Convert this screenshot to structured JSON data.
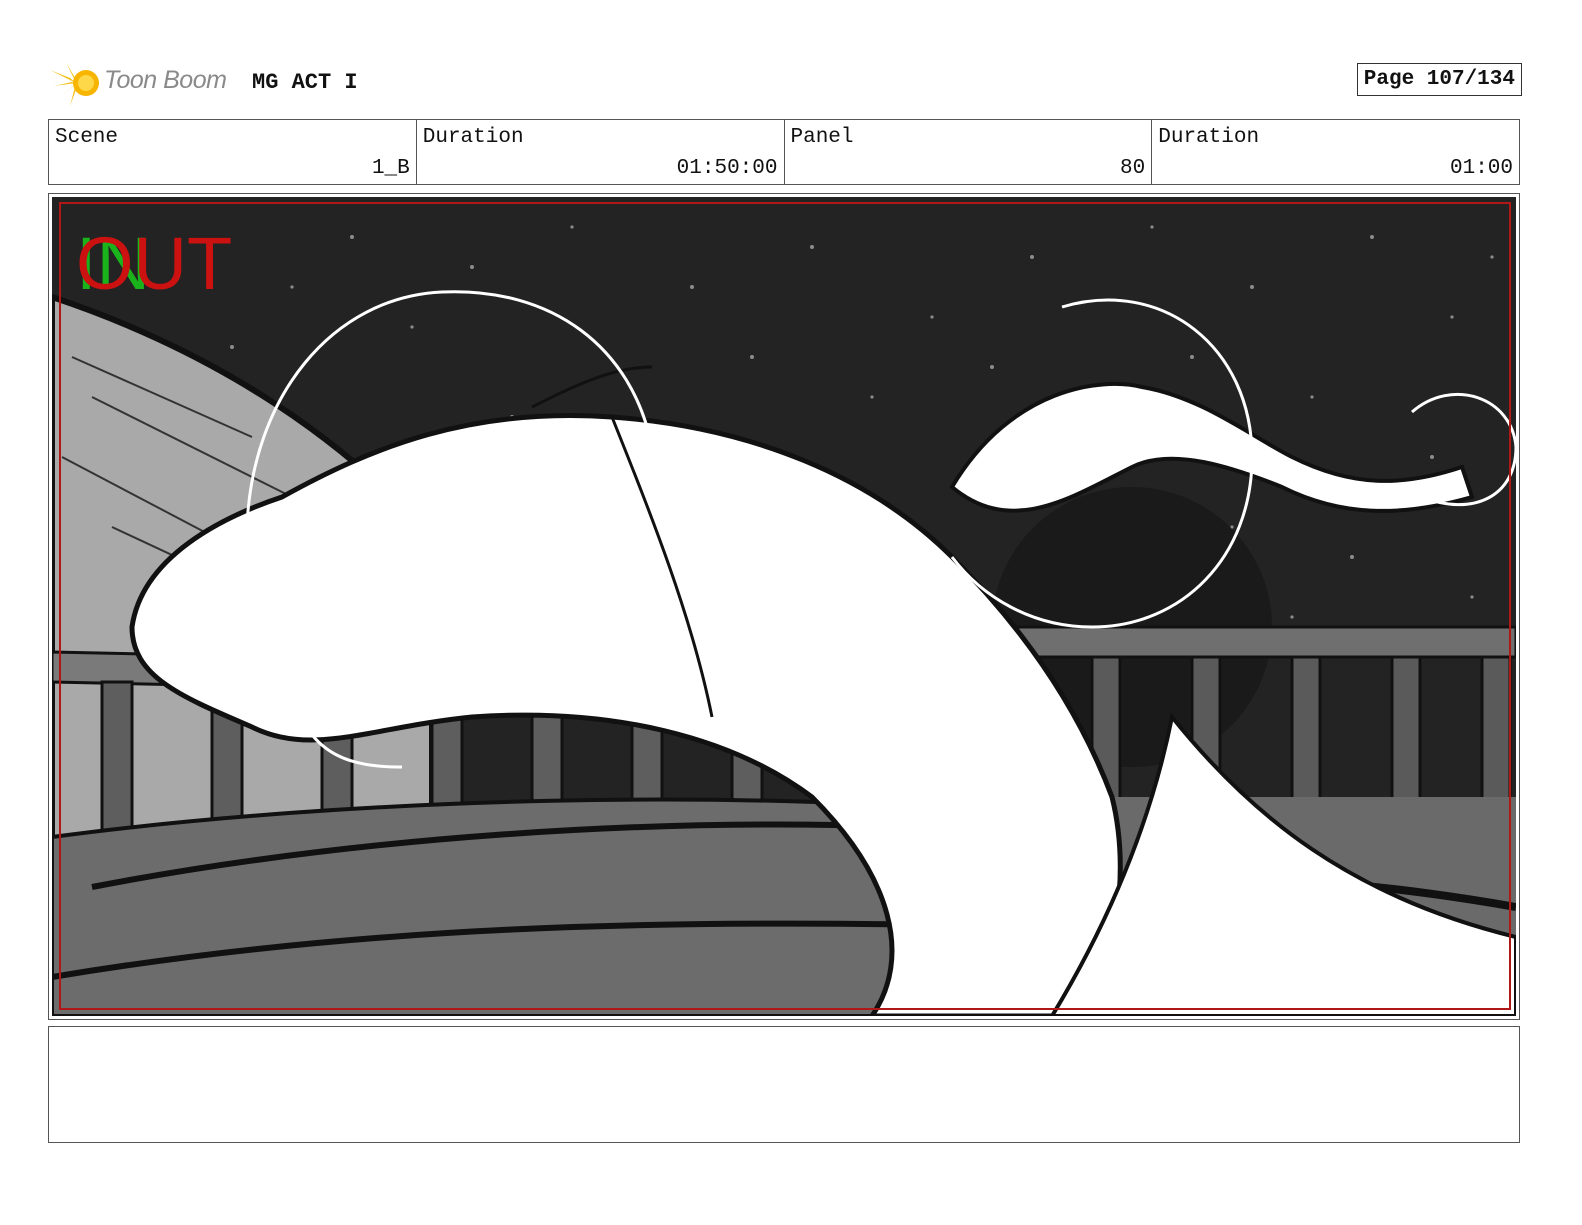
{
  "header": {
    "brand": "Toon Boom",
    "project_title": "MG ACT I",
    "page_label": "Page 107/134"
  },
  "meta": {
    "scene_label": "Scene",
    "scene_value": "1_B",
    "scene_duration_label": "Duration",
    "scene_duration_value": "01:50:00",
    "panel_label": "Panel",
    "panel_value": "80",
    "panel_duration_label": "Duration",
    "panel_duration_value": "01:00"
  },
  "panel": {
    "in_marker": "IN",
    "out_marker": "OUT",
    "in_color": "#1bb31b",
    "out_color": "#cc1111",
    "safe_frame_color": "#b01818"
  },
  "notes": {
    "text": ""
  }
}
